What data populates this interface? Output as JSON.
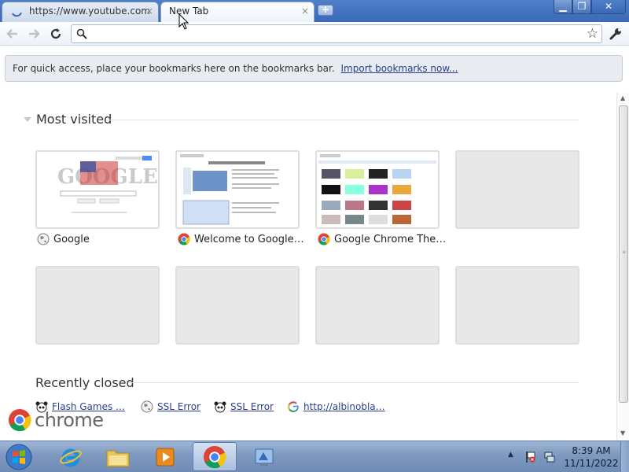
{
  "tabs": [
    {
      "title": "https://www.youtube.com",
      "close": "×",
      "active": false
    },
    {
      "title": "New Tab",
      "close": "×",
      "active": true
    }
  ],
  "window_controls": {
    "minimize": "▁",
    "maximize": "❐",
    "close": "✕"
  },
  "new_tab_symbol": "+",
  "toolbar": {
    "back_icon": "back-arrow-icon",
    "forward_icon": "forward-arrow-icon",
    "reload_icon": "reload-icon",
    "omnibox_value": "",
    "omnibox_placeholder": "",
    "star_icon": "☆",
    "wrench_icon": "wrench-icon"
  },
  "bookmark_bar": {
    "message": "For quick access, place your bookmarks here on the bookmarks bar.",
    "link": "Import bookmarks now..."
  },
  "most_visited": {
    "header": "Most visited",
    "tiles": [
      {
        "title": "Google",
        "favicon": "globe-icon",
        "filled": true
      },
      {
        "title": "Welcome to Google…",
        "favicon": "chrome-icon",
        "filled": true
      },
      {
        "title": "Google Chrome The…",
        "favicon": "chrome-icon",
        "filled": true
      },
      {
        "title": "",
        "filled": false
      },
      {
        "title": "",
        "filled": false
      },
      {
        "title": "",
        "filled": false
      },
      {
        "title": "",
        "filled": false
      },
      {
        "title": "",
        "filled": false
      }
    ]
  },
  "recently_closed": {
    "header": "Recently closed",
    "items": [
      {
        "label": "Flash Games …",
        "favicon": "panda-icon"
      },
      {
        "label": "SSL Error",
        "favicon": "globe-icon"
      },
      {
        "label": "SSL Error",
        "favicon": "panda-icon"
      },
      {
        "label": "http://albinobla…",
        "favicon": "google-g-icon"
      }
    ]
  },
  "branding": {
    "logo_text": "chrome"
  },
  "taskbar": {
    "items": [
      "windows-start-icon",
      "internet-explorer-icon",
      "folder-icon",
      "media-player-icon",
      "chrome-icon",
      "app-icon"
    ],
    "clock_time": "8:39 AM",
    "clock_date": "11/11/2022",
    "tray_up": "▲"
  },
  "colors": {
    "accent_blue": "#3a6ab8",
    "link": "#2a3f8f",
    "tile_border": "#dedede"
  }
}
